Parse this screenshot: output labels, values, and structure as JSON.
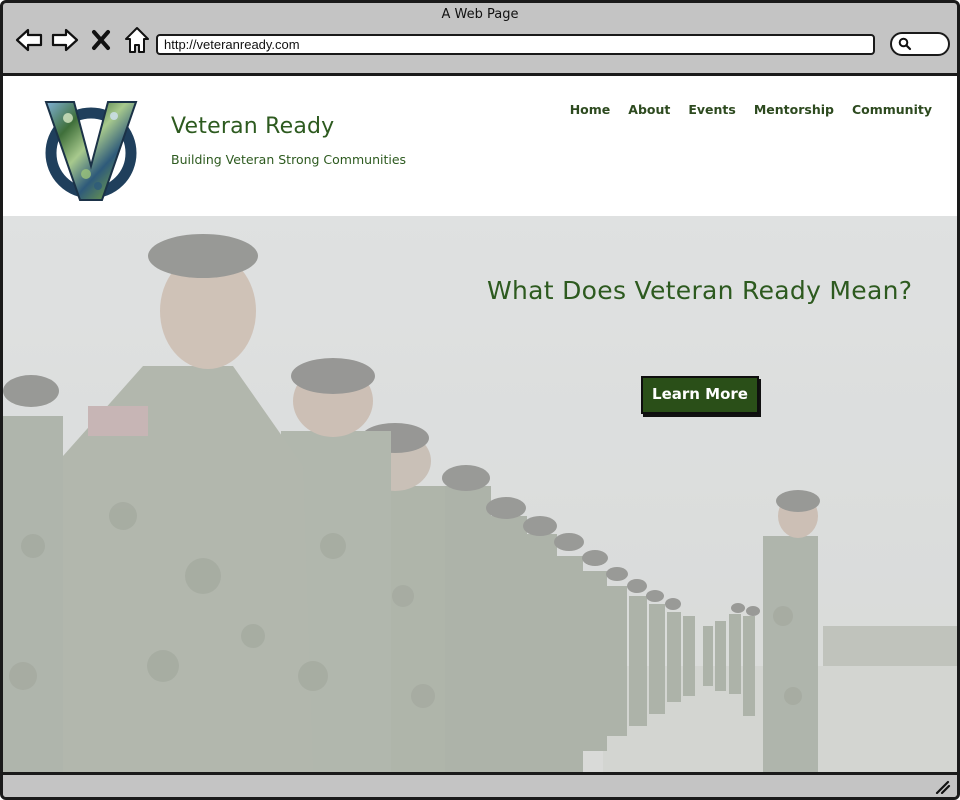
{
  "browser": {
    "window_title": "A Web Page",
    "url": "http://veteranready.com",
    "nav_icons": [
      "back-arrow-icon",
      "forward-arrow-icon",
      "close-x-icon",
      "home-icon"
    ],
    "search_icon": "search-icon"
  },
  "site": {
    "brand": {
      "title": "Veteran Ready",
      "tagline": "Building Veteran Strong Communities",
      "logo_letter": "V"
    },
    "nav": [
      {
        "label": "Home"
      },
      {
        "label": "About"
      },
      {
        "label": "Events"
      },
      {
        "label": "Mentorship"
      },
      {
        "label": "Community"
      }
    ],
    "hero": {
      "heading": "What Does Veteran Ready Mean?",
      "cta_label": "Learn More",
      "background": "soldiers-in-formation-photo"
    }
  },
  "colors": {
    "brand_green": "#2d5a1f",
    "button_green": "#2a4f18",
    "frame_gray": "#c4c4c4",
    "logo_ring": "#1f3f5c"
  }
}
